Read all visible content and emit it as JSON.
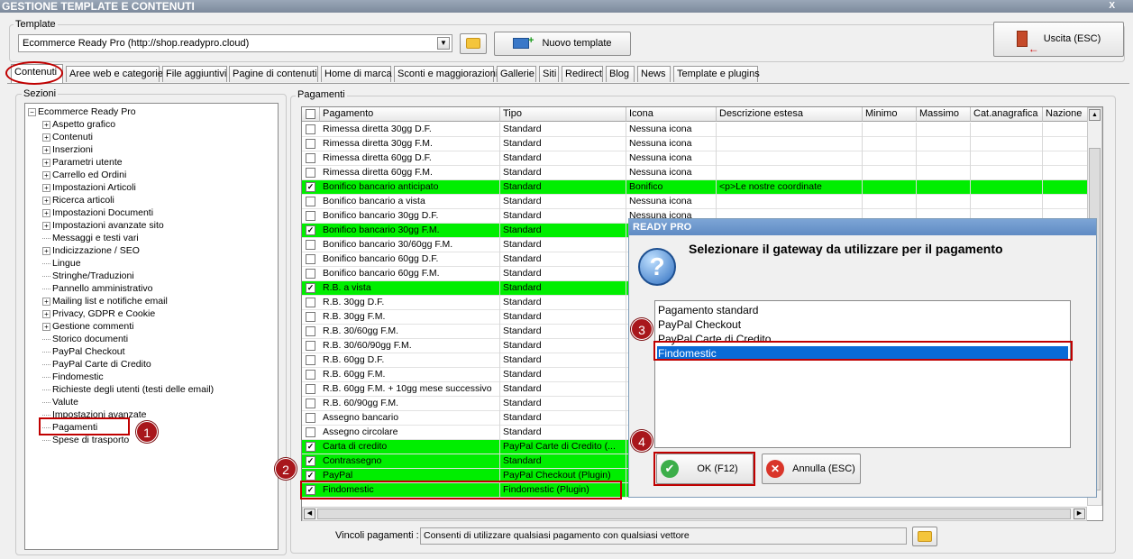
{
  "window": {
    "title": "GESTIONE TEMPLATE E CONTENUTI",
    "close": "X"
  },
  "template": {
    "legend": "Template",
    "selected": "Ecommerce Ready Pro (http://shop.readypro.cloud)",
    "new_button": "Nuovo template",
    "exit_button": "Uscita (ESC)"
  },
  "tabs": [
    "Contenuti",
    "Aree web e categorie",
    "File aggiuntivi",
    "Pagine di contenuti",
    "Home di marca",
    "Sconti e maggiorazioni",
    "Gallerie",
    "Siti",
    "Redirect",
    "Blog",
    "News",
    "Template e plugins"
  ],
  "sections": {
    "legend": "Sezioni",
    "root": "Ecommerce Ready Pro",
    "items": [
      {
        "label": "Aspetto grafico",
        "expandable": true
      },
      {
        "label": "Contenuti",
        "expandable": true
      },
      {
        "label": "Inserzioni",
        "expandable": true
      },
      {
        "label": "Parametri utente",
        "expandable": true
      },
      {
        "label": "Carrello ed Ordini",
        "expandable": true
      },
      {
        "label": "Impostazioni Articoli",
        "expandable": true
      },
      {
        "label": "Ricerca articoli",
        "expandable": true
      },
      {
        "label": "Impostazioni Documenti",
        "expandable": true
      },
      {
        "label": "Impostazioni avanzate sito",
        "expandable": true
      },
      {
        "label": "Messaggi e testi vari",
        "expandable": false
      },
      {
        "label": "Indicizzazione / SEO",
        "expandable": true
      },
      {
        "label": "Lingue",
        "expandable": false
      },
      {
        "label": "Stringhe/Traduzioni",
        "expandable": false
      },
      {
        "label": "Pannello amministrativo",
        "expandable": false
      },
      {
        "label": "Mailing list e notifiche email",
        "expandable": true
      },
      {
        "label": "Privacy, GDPR e Cookie",
        "expandable": true
      },
      {
        "label": "Gestione commenti",
        "expandable": true
      },
      {
        "label": "Storico documenti",
        "expandable": false
      },
      {
        "label": "PayPal Checkout",
        "expandable": false
      },
      {
        "label": "PayPal Carte di Credito",
        "expandable": false
      },
      {
        "label": "Findomestic",
        "expandable": false
      },
      {
        "label": "Richieste degli utenti (testi delle email)",
        "expandable": false
      },
      {
        "label": "Valute",
        "expandable": false
      },
      {
        "label": "Impostazioni avanzate",
        "expandable": false
      },
      {
        "label": "Pagamenti",
        "expandable": false
      },
      {
        "label": "Spese di trasporto",
        "expandable": false
      }
    ]
  },
  "payments": {
    "legend": "Pagamenti",
    "columns": [
      "Pagamento",
      "Tipo",
      "Icona",
      "Descrizione estesa",
      "Minimo",
      "Massimo",
      "Cat.anagrafica",
      "Nazione"
    ],
    "rows": [
      {
        "checked": false,
        "green": false,
        "name": "Rimessa diretta 30gg D.F.",
        "tipo": "Standard",
        "icona": "Nessuna icona",
        "desc": ""
      },
      {
        "checked": false,
        "green": false,
        "name": "Rimessa diretta 30gg F.M.",
        "tipo": "Standard",
        "icona": "Nessuna icona",
        "desc": ""
      },
      {
        "checked": false,
        "green": false,
        "name": "Rimessa diretta 60gg D.F.",
        "tipo": "Standard",
        "icona": "Nessuna icona",
        "desc": ""
      },
      {
        "checked": false,
        "green": false,
        "name": "Rimessa diretta 60gg F.M.",
        "tipo": "Standard",
        "icona": "Nessuna icona",
        "desc": ""
      },
      {
        "checked": true,
        "green": true,
        "name": "Bonifico bancario anticipato",
        "tipo": "Standard",
        "icona": "Bonifico",
        "desc": "<p>Le nostre coordinate"
      },
      {
        "checked": false,
        "green": false,
        "name": "Bonifico bancario a vista",
        "tipo": "Standard",
        "icona": "Nessuna icona",
        "desc": ""
      },
      {
        "checked": false,
        "green": false,
        "name": "Bonifico bancario 30gg D.F.",
        "tipo": "Standard",
        "icona": "Nessuna icona",
        "desc": ""
      },
      {
        "checked": true,
        "green": true,
        "name": "Bonifico bancario 30gg F.M.",
        "tipo": "Standard",
        "icona": "",
        "desc": ""
      },
      {
        "checked": false,
        "green": false,
        "name": "Bonifico bancario 30/60gg F.M.",
        "tipo": "Standard",
        "icona": "",
        "desc": ""
      },
      {
        "checked": false,
        "green": false,
        "name": "Bonifico bancario 60gg D.F.",
        "tipo": "Standard",
        "icona": "",
        "desc": ""
      },
      {
        "checked": false,
        "green": false,
        "name": "Bonifico bancario 60gg F.M.",
        "tipo": "Standard",
        "icona": "",
        "desc": ""
      },
      {
        "checked": true,
        "green": true,
        "name": "R.B. a vista",
        "tipo": "Standard",
        "icona": "",
        "desc": ""
      },
      {
        "checked": false,
        "green": false,
        "name": "R.B. 30gg D.F.",
        "tipo": "Standard",
        "icona": "",
        "desc": ""
      },
      {
        "checked": false,
        "green": false,
        "name": "R.B. 30gg F.M.",
        "tipo": "Standard",
        "icona": "",
        "desc": ""
      },
      {
        "checked": false,
        "green": false,
        "name": "R.B. 30/60gg F.M.",
        "tipo": "Standard",
        "icona": "",
        "desc": ""
      },
      {
        "checked": false,
        "green": false,
        "name": "R.B. 30/60/90gg F.M.",
        "tipo": "Standard",
        "icona": "",
        "desc": ""
      },
      {
        "checked": false,
        "green": false,
        "name": "R.B. 60gg D.F.",
        "tipo": "Standard",
        "icona": "",
        "desc": ""
      },
      {
        "checked": false,
        "green": false,
        "name": "R.B. 60gg F.M.",
        "tipo": "Standard",
        "icona": "",
        "desc": ""
      },
      {
        "checked": false,
        "green": false,
        "name": "R.B. 60gg F.M. + 10gg mese successivo",
        "tipo": "Standard",
        "icona": "",
        "desc": ""
      },
      {
        "checked": false,
        "green": false,
        "name": "R.B. 60/90gg F.M.",
        "tipo": "Standard",
        "icona": "",
        "desc": ""
      },
      {
        "checked": false,
        "green": false,
        "name": "Assegno bancario",
        "tipo": "Standard",
        "icona": "",
        "desc": ""
      },
      {
        "checked": false,
        "green": false,
        "name": "Assegno circolare",
        "tipo": "Standard",
        "icona": "",
        "desc": ""
      },
      {
        "checked": true,
        "green": true,
        "name": "Carta di credito",
        "tipo": "PayPal Carte di Credito (...",
        "icona": "",
        "desc": ""
      },
      {
        "checked": true,
        "green": true,
        "name": "Contrassegno",
        "tipo": "Standard",
        "icona": "",
        "desc": ""
      },
      {
        "checked": true,
        "green": true,
        "name": "PayPal",
        "tipo": "PayPal Checkout (Plugin)",
        "icona": "",
        "desc": ""
      },
      {
        "checked": true,
        "green": true,
        "name": "Findomestic",
        "tipo": "Findomestic (Plugin)",
        "icona": "",
        "desc": ""
      }
    ],
    "constraints_label": "Vincoli pagamenti :",
    "constraints_value": "Consenti di utilizzare qualsiasi pagamento con qualsiasi vettore"
  },
  "dialog": {
    "title": "READY PRO",
    "question": "Selezionare il gateway da utilizzare per il pagamento",
    "options": [
      "Pagamento standard",
      "PayPal Checkout",
      "PayPal Carte di Credito",
      "Findomestic"
    ],
    "selected_index": 3,
    "ok": "OK (F12)",
    "cancel": "Annulla (ESC)"
  },
  "badges": [
    "1",
    "2",
    "3",
    "4"
  ],
  "colors": {
    "highlight": "#c00000",
    "green_row": "#00ee00",
    "selection": "#0a6bd6",
    "badge": "#a8171c"
  }
}
